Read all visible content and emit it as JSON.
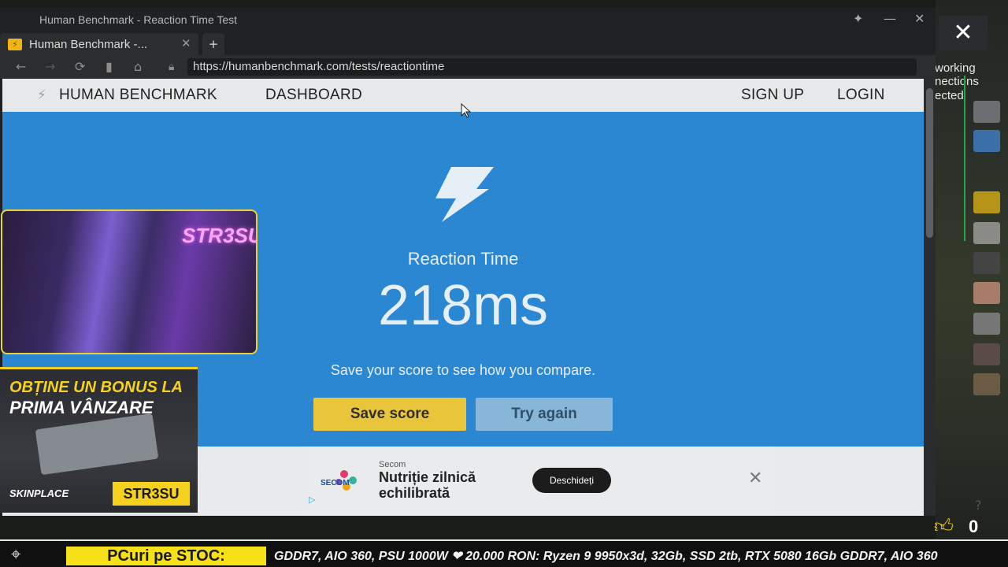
{
  "window": {
    "title": "Human Benchmark - Reaction Time Test",
    "tab_title": "Human Benchmark -...",
    "url": "https://humanbenchmark.com/tests/reactiontime",
    "icons": [
      "pin-icon",
      "minimize-icon",
      "close-icon",
      "back-icon",
      "forward-icon",
      "reload-icon",
      "bookmark-icon",
      "home-icon",
      "lock-icon"
    ]
  },
  "site": {
    "brand": "HUMAN BENCHMARK",
    "nav": {
      "dashboard": "DASHBOARD",
      "signup": "SIGN UP",
      "login": "LOGIN"
    }
  },
  "result": {
    "label": "Reaction Time",
    "value": "218ms",
    "message": "Save your score to see how you compare.",
    "save_button": "Save score",
    "retry_button": "Try again",
    "colors": {
      "hero": "#2b87d1",
      "save": "#e9c53c",
      "retry": "#87b6d9"
    }
  },
  "ad": {
    "brand": "Secom",
    "logo_text": "SECOM",
    "title": "Nutriție zilnică echilibrată",
    "cta": "Deschideți"
  },
  "overlay": {
    "right_lines": [
      "working",
      "nections",
      "ected"
    ],
    "promo": {
      "line1": "OBȚINE UN BONUS LA",
      "line2": "PRIMA VÂNZARE",
      "brand": "SKINPLACE",
      "code": "STR3SU"
    },
    "webcam_sign": "STR3SU",
    "ticker_label": "PCuri pe STOC:",
    "ticker_text": "GDDR7, AIO 360, PSU 1000W  ❤ 20.000 RON: Ryzen 9 9950x3d, 32Gb, SSD 2tb, RTX 5080 16Gb GDDR7, AIO 360",
    "like_count": "0"
  }
}
